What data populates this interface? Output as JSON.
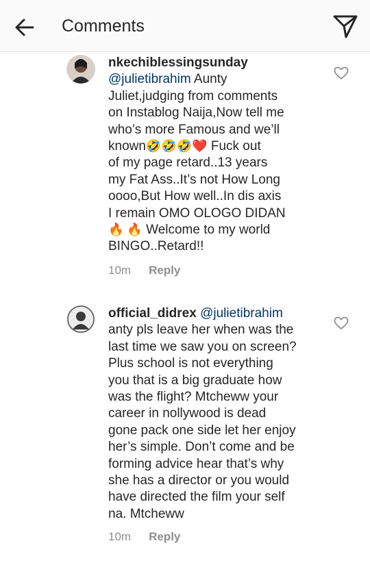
{
  "header": {
    "title": "Comments"
  },
  "comments": [
    {
      "username": "nkechiblessingsunday",
      "mention": "@julietibrahim",
      "lines": [
        "Aunty",
        "Juliet,judging from comments",
        "on Instablog Naija,Now tell me",
        "who’s more Famous and we’ll",
        "known",
        "🤣🤣🤣❤️",
        " Fuck out",
        "of my page retard..13 years",
        "my Fat Ass..It’s not How Long",
        "oooo,But How well..In dis axis",
        "I remain OMO OLOGO DIDAN",
        "🔥 🔥",
        " Welcome to my world",
        "BINGO..Retard!!"
      ],
      "time": "10m",
      "reply_label": "Reply"
    },
    {
      "username": "official_didrex",
      "mention": "@julietibrahim",
      "lines": [
        "anty pls leave her when was the",
        "last time we saw you on screen?",
        "Plus school is not everything",
        "you that is a big graduate how",
        "was the flight? Mtcheww your",
        "career in nollywood is dead",
        "gone pack one side let her enjoy",
        "her’s simple. Don’t come and be",
        "forming advice hear that’s why",
        "she has a director or you would",
        "have directed the film your self",
        "na. Mtcheww"
      ],
      "time": "10m",
      "reply_label": "Reply"
    }
  ]
}
